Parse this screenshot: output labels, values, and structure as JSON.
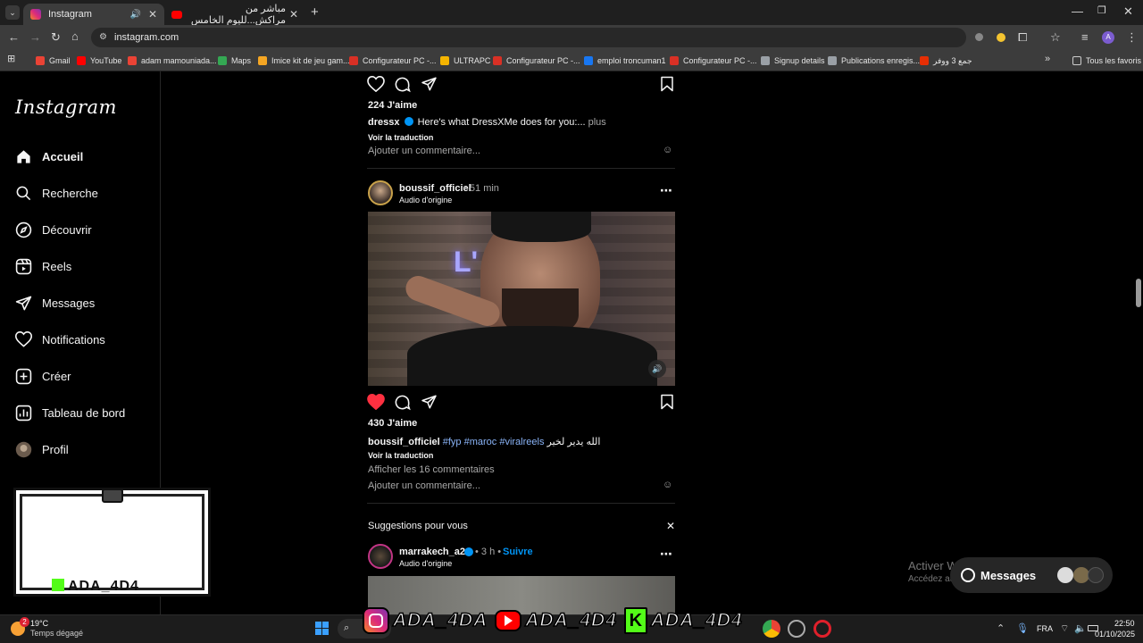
{
  "browser": {
    "tabs": [
      {
        "title": "Instagram",
        "active": true,
        "icon": "instagram-icon"
      },
      {
        "title": "مباشر من مراكش...لليوم الخامس",
        "active": false,
        "icon": "youtube-icon"
      }
    ],
    "new_tab": "+",
    "url": "instagram.com",
    "bookmarks": [
      {
        "label": "Gmail",
        "icon": "gmail-icon",
        "color": "#ea4335"
      },
      {
        "label": "YouTube",
        "icon": "youtube-icon",
        "color": "#ff0000"
      },
      {
        "label": "adam mamouniada...",
        "icon": "gmail-icon",
        "color": "#ea4335"
      },
      {
        "label": "Maps",
        "icon": "maps-icon",
        "color": "#34a853"
      },
      {
        "label": "Imice kit de jeu gam...",
        "icon": "aliexpress-icon",
        "color": "#f5a623"
      },
      {
        "label": "Configurateur PC -...",
        "icon": "pc-icon",
        "color": "#d93025"
      },
      {
        "label": "ULTRAPC",
        "icon": "ultrapc-icon",
        "color": "#f4b400"
      },
      {
        "label": "Configurateur PC -...",
        "icon": "pc-icon",
        "color": "#d93025"
      },
      {
        "label": "emploi troncuman1",
        "icon": "facebook-icon",
        "color": "#1877f2"
      },
      {
        "label": "Configurateur PC -...",
        "icon": "pc-icon",
        "color": "#d93025"
      },
      {
        "label": "Signup details",
        "icon": "globe-icon",
        "color": "#9aa0a6"
      },
      {
        "label": "Publications enregis...",
        "icon": "globe-icon",
        "color": "#9aa0a6"
      },
      {
        "label": "جمع 3 ووفر",
        "icon": "aliexpress-icon",
        "color": "#e62e04"
      }
    ],
    "all_bookmarks": "Tous les favoris"
  },
  "sidebar": {
    "logo": "Instagram",
    "items": [
      {
        "label": "Accueil",
        "icon": "home-icon"
      },
      {
        "label": "Recherche",
        "icon": "search-icon"
      },
      {
        "label": "Découvrir",
        "icon": "compass-icon"
      },
      {
        "label": "Reels",
        "icon": "reels-icon"
      },
      {
        "label": "Messages",
        "icon": "send-icon"
      },
      {
        "label": "Notifications",
        "icon": "heart-icon"
      },
      {
        "label": "Créer",
        "icon": "plus-square-icon"
      },
      {
        "label": "Tableau de bord",
        "icon": "dashboard-icon"
      },
      {
        "label": "Profil",
        "icon": "avatar"
      }
    ],
    "stream_overlay_name": "ADA_4D4"
  },
  "feed": {
    "post1": {
      "likes": "224 J'aime",
      "username": "dressx",
      "caption": "Here's what DressXMe does for you:...",
      "more": "plus",
      "translate": "Voir la traduction",
      "comment_placeholder": "Ajouter un commentaire..."
    },
    "post2": {
      "username": "boussif_officiel",
      "time": "• 51 min",
      "audio": "Audio d'origine",
      "likes": "430 J'aime",
      "caption_user": "boussif_officiel",
      "hashtags": "#fyp #maroc #viralreels",
      "caption_ar": "الله يدير لخير",
      "translate": "Voir la traduction",
      "view_comments": "Afficher les 16 commentaires",
      "comment_placeholder": "Ajouter un commentaire...",
      "liked": true
    },
    "suggestions": {
      "title": "Suggestions pour vous",
      "username": "marrakech_a26",
      "time": "• 3 h •",
      "follow": "Suivre",
      "audio": "Audio d'origine"
    }
  },
  "messages_pill": {
    "label": "Messages"
  },
  "windows_activation": {
    "line1": "Activer Windows",
    "line2": "Accédez aux paramètres pour activer Windows."
  },
  "taskbar": {
    "weather_temp": "19°C",
    "weather_desc": "Temps dégagé",
    "weather_badge": "2",
    "language": "FRA",
    "time": "22:50",
    "date": "01/10/2025",
    "overlay_names": [
      "ADA_4DA",
      "ADA_4D4",
      "ADA_4D4"
    ]
  },
  "colors": {
    "like_red": "#ff3040",
    "link_blue": "#e0f1ff",
    "hashtag_blue": "#8ab4f8",
    "follow_blue": "#0095f6",
    "verified_blue": "#0095f6"
  }
}
